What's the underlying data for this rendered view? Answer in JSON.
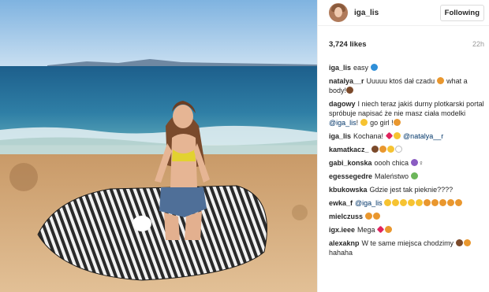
{
  "post": {
    "username": "iga_lis",
    "follow_label": "Following",
    "likes": "3,724 likes",
    "time": "22h"
  },
  "comments": [
    {
      "user": "iga_lis",
      "text": "easy",
      "emoji": [
        "e-blue"
      ]
    },
    {
      "user": "natalya__r",
      "text": "Uuuuu ktoś dał czadu",
      "emoji": [
        "e-orange"
      ],
      "after": "what a body!",
      "emoji2": [
        "e-brown"
      ]
    },
    {
      "user": "dagowy",
      "text": "I niech teraz jakiś durny plotkarski portal spróbuje napisać że nie masz ciała modelki",
      "mention": "@iga_lis",
      "tail": "! ",
      "emoji": [
        "e-yellow"
      ],
      "after": "go girl !",
      "emoji2": [
        "e-orange"
      ]
    },
    {
      "user": "iga_lis",
      "text": "Kochana!",
      "emoji": [
        "e-red",
        "e-yellow"
      ],
      "mention": "@natalya__r"
    },
    {
      "user": "kamatkacz_",
      "text": "",
      "emoji": [
        "e-brown",
        "e-orange",
        "e-yellow",
        "e-white"
      ]
    },
    {
      "user": "gabi_konska",
      "text": "oooh chica",
      "emoji": [
        "e-purple"
      ],
      "tail": "♀"
    },
    {
      "user": "egessegedre",
      "text": "Maleństwo",
      "emoji": [
        "e-green"
      ]
    },
    {
      "user": "kbukowska",
      "text": "Gdzie jest tak pieknie????",
      "emoji": []
    },
    {
      "user": "ewka_f",
      "text": "",
      "mention": "@iga_lis",
      "emoji": [
        "e-yellow",
        "e-yellow",
        "e-yellow",
        "e-yellow",
        "e-yellow",
        "e-orange",
        "e-orange",
        "e-orange",
        "e-orange",
        "e-orange"
      ]
    },
    {
      "user": "mielczuss",
      "text": "",
      "emoji": [
        "e-orange",
        "e-orange"
      ]
    },
    {
      "user": "igx.ieee",
      "text": "Mega",
      "emoji": [
        "e-red",
        "e-orange"
      ]
    },
    {
      "user": "alexaknp",
      "text": "W te same miejsca chodzimy",
      "emoji": [
        "e-brown",
        "e-orange"
      ],
      "after": "hahaha"
    }
  ]
}
